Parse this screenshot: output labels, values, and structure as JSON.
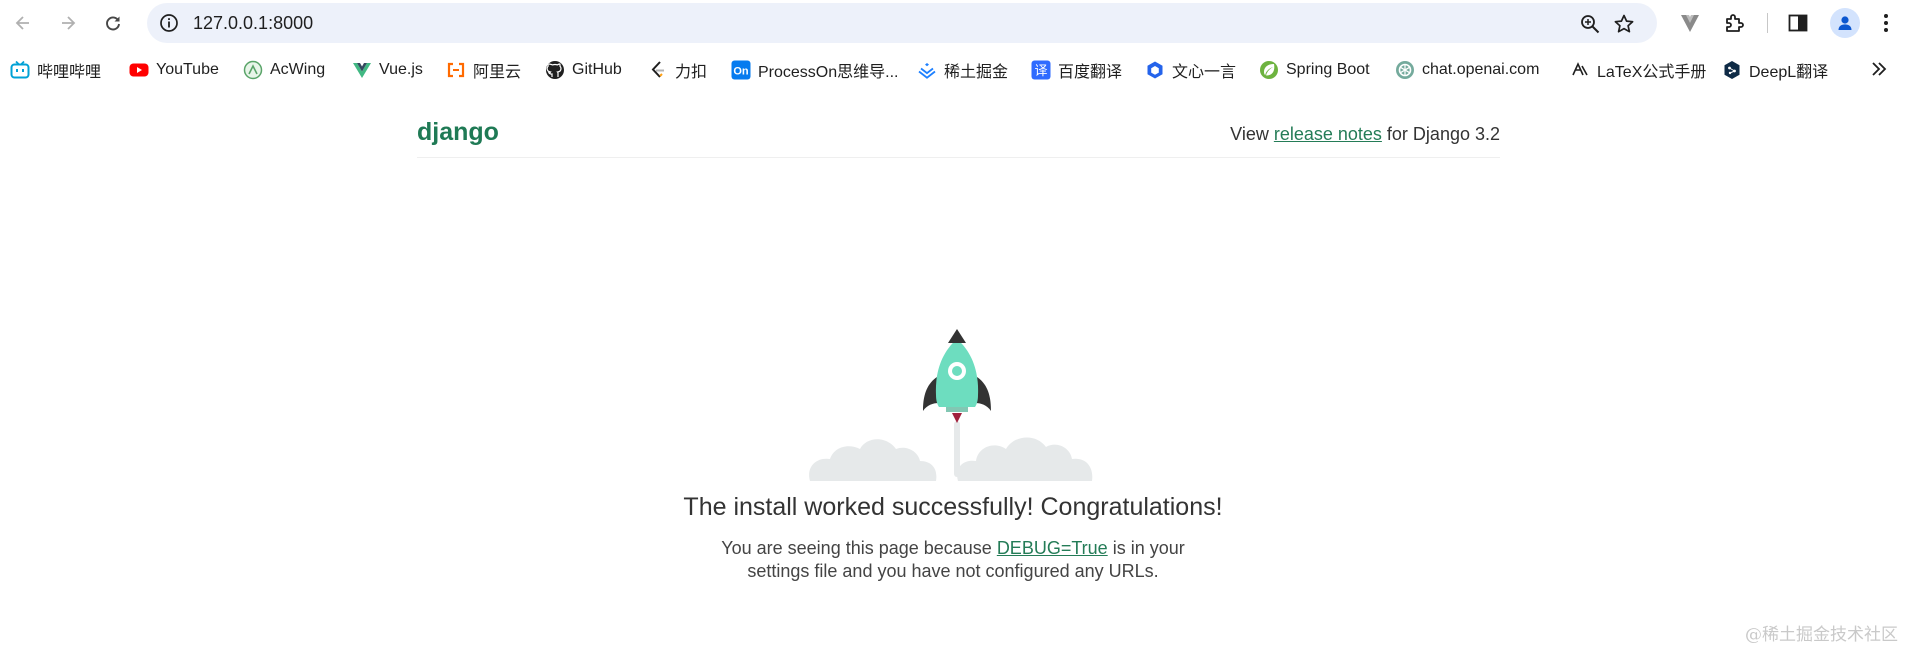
{
  "browser": {
    "url": "127.0.0.1:8000",
    "bookmarks": [
      {
        "label": "哔哩哔哩",
        "icon": "bilibili-icon"
      },
      {
        "label": "YouTube",
        "icon": "youtube-icon"
      },
      {
        "label": "AcWing",
        "icon": "acwing-icon"
      },
      {
        "label": "Vue.js",
        "icon": "vue-icon"
      },
      {
        "label": "阿里云",
        "icon": "aliyun-icon"
      },
      {
        "label": "GitHub",
        "icon": "github-icon"
      },
      {
        "label": "力扣",
        "icon": "leetcode-icon"
      },
      {
        "label": "ProcessOn思维导...",
        "icon": "processon-icon"
      },
      {
        "label": "稀土掘金",
        "icon": "juejin-icon"
      },
      {
        "label": "百度翻译",
        "icon": "baidu-translate-icon"
      },
      {
        "label": "文心一言",
        "icon": "wenxin-icon"
      },
      {
        "label": "Spring Boot",
        "icon": "spring-icon"
      },
      {
        "label": "chat.openai.com",
        "icon": "openai-icon"
      },
      {
        "label": "LaTeX公式手册",
        "icon": "latex-icon"
      },
      {
        "label": "DeepL翻译",
        "icon": "deepl-icon"
      }
    ]
  },
  "page": {
    "logo": "django",
    "notes_prefix": "View ",
    "notes_link": "release notes",
    "notes_suffix": " for Django 3.2",
    "title": "The install worked successfully! Congratulations!",
    "desc_prefix": "You are seeing this page because ",
    "desc_link": "DEBUG=True",
    "desc_middle": " is in your",
    "desc_line2": "settings file and you have not configured any URLs.",
    "watermark": "@稀土掘金技术社区"
  },
  "colors": {
    "django_green": "#1f7a55",
    "rocket_body": "#6dddbf",
    "cloud": "#e6e9ea",
    "omnibox_bg": "#edf1fa"
  }
}
